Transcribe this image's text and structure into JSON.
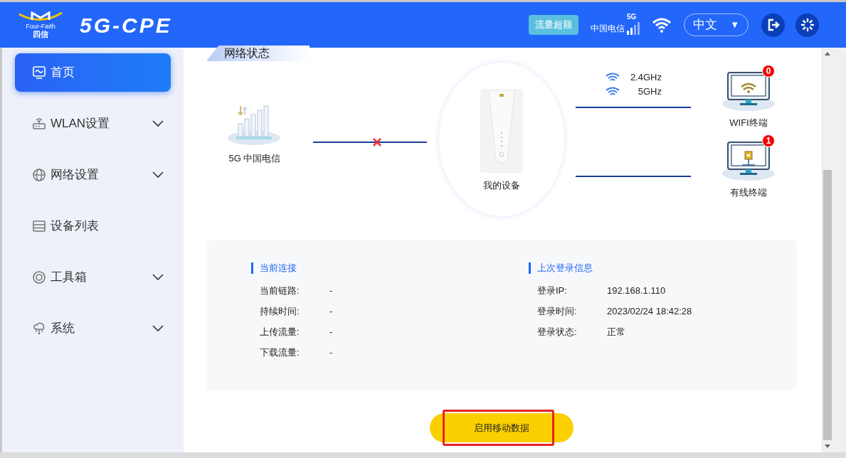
{
  "header": {
    "logo_text": [
      "Four-Faith",
      "四信"
    ],
    "product": "5G-CPE",
    "traffic_badge": "流量超额",
    "carrier": "中国电信",
    "signal_label": "5G",
    "language": {
      "value": "中文",
      "arrow": "▼"
    }
  },
  "sidebar": {
    "items": [
      {
        "label": "首页",
        "kind": "home",
        "selected": true,
        "expandable": false
      },
      {
        "label": "WLAN设置",
        "kind": "router",
        "selected": false,
        "expandable": true
      },
      {
        "label": "网络设置",
        "kind": "globe",
        "selected": false,
        "expandable": true
      },
      {
        "label": "设备列表",
        "kind": "list",
        "selected": false,
        "expandable": false
      },
      {
        "label": "工具箱",
        "kind": "tools",
        "selected": false,
        "expandable": true
      },
      {
        "label": "系统",
        "kind": "system",
        "selected": false,
        "expandable": true
      }
    ]
  },
  "section_title": "网络状态",
  "diagram": {
    "uplink_label": "5G 中国电信",
    "uplink_connected": false,
    "device_label": "我的设备",
    "bands": [
      "2.4GHz",
      "5GHz"
    ],
    "terminals": [
      {
        "kind": "wifi",
        "label": "WIFI终端",
        "count": "0"
      },
      {
        "kind": "wired",
        "label": "有线终端",
        "count": "1"
      }
    ]
  },
  "info": [
    {
      "title": "当前连接",
      "rows": [
        {
          "label": "当前链路:",
          "value": "-"
        },
        {
          "label": "持续时间:",
          "value": "-"
        },
        {
          "label": "上传流量:",
          "value": "-"
        },
        {
          "label": "下载流量:",
          "value": "-"
        }
      ]
    },
    {
      "title": "上次登录信息",
      "rows": [
        {
          "label": "登录IP:",
          "value": "192.168.1.110"
        },
        {
          "label": "登录时间:",
          "value": "2023/02/24 18:42:28"
        },
        {
          "label": "登录状态:",
          "value": "正常"
        }
      ]
    }
  ],
  "action_button": {
    "label": "启用移动数据",
    "highlighted": true
  }
}
